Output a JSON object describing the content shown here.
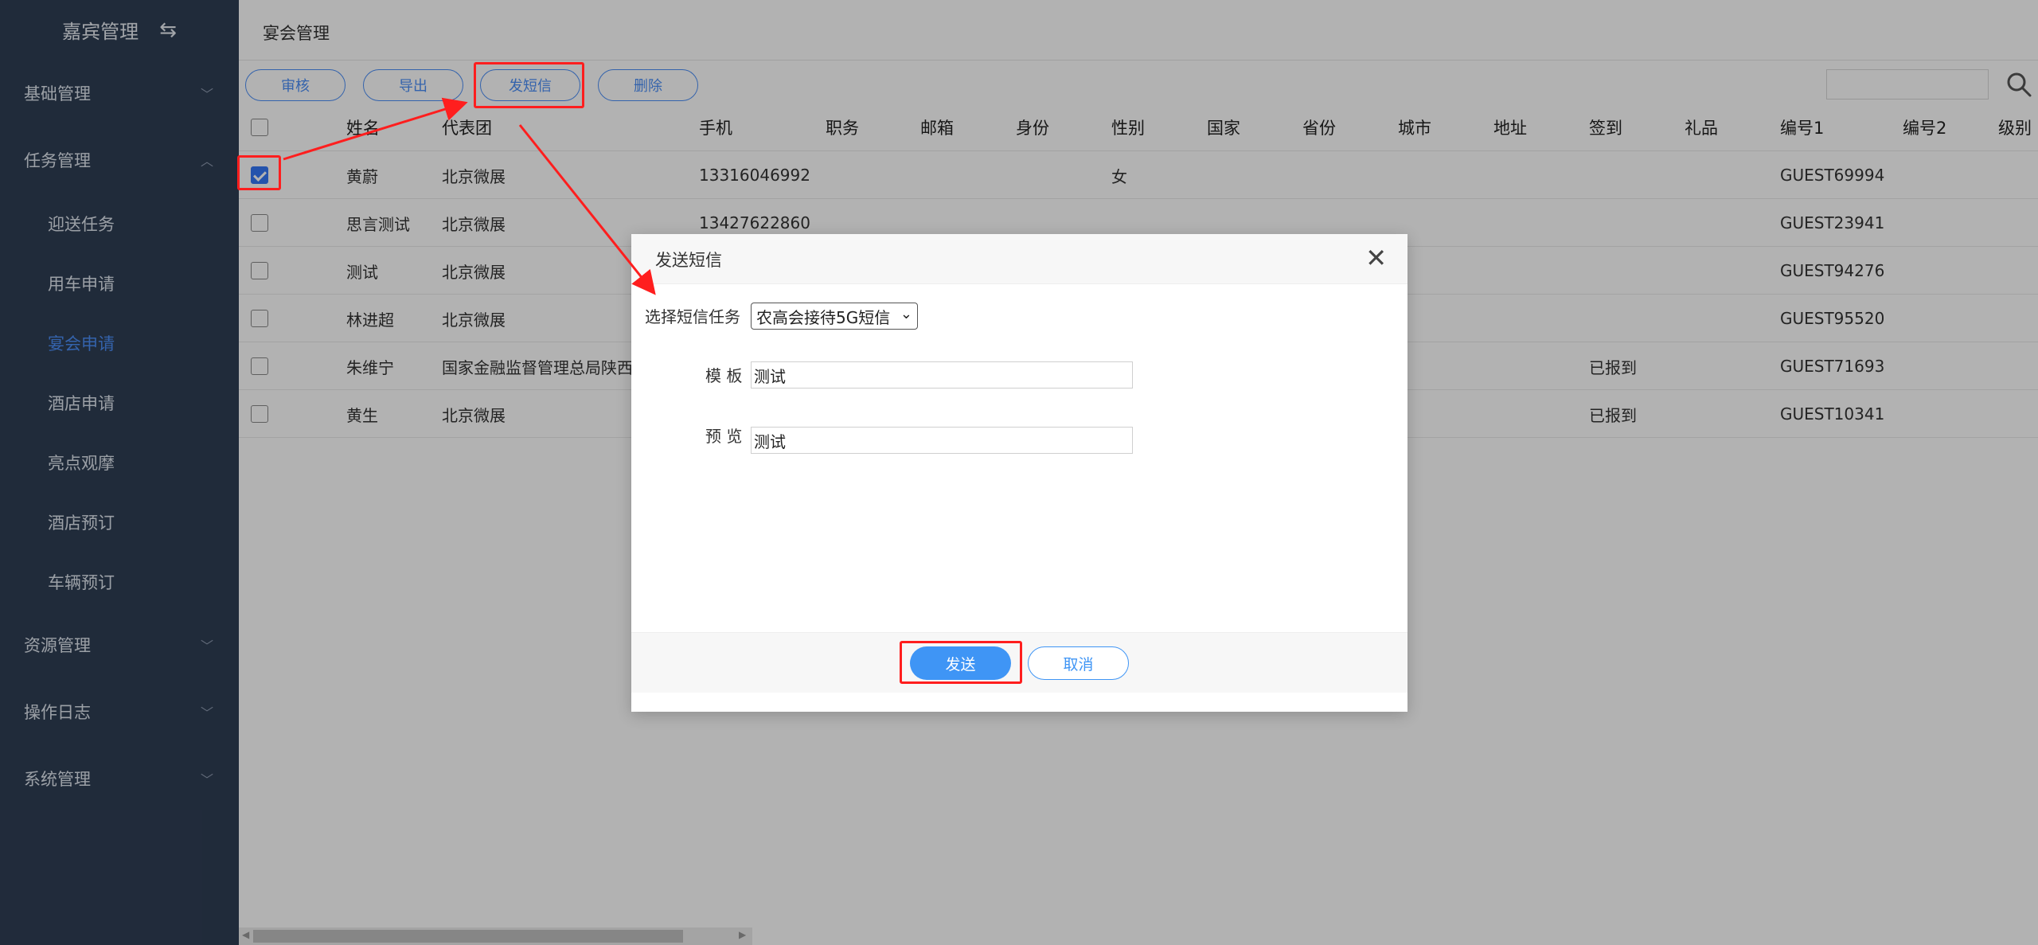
{
  "sidebar": {
    "title": "嘉宾管理",
    "toggle_icon": "swap-icon",
    "groups": [
      {
        "label": "基础管理",
        "expanded": false
      },
      {
        "label": "任务管理",
        "expanded": true
      },
      {
        "label": "资源管理",
        "expanded": false
      },
      {
        "label": "操作日志",
        "expanded": false
      },
      {
        "label": "系统管理",
        "expanded": false
      }
    ],
    "task_items": [
      "迎送任务",
      "用车申请",
      "宴会申请",
      "酒店申请",
      "亮点观摩",
      "酒店预订",
      "车辆预订"
    ],
    "active_item": "宴会申请",
    "colors": {
      "background": "#2f3e54",
      "active": "#4b8ef7"
    }
  },
  "main": {
    "tab_title": "宴会管理",
    "toolbar": {
      "approve_label": "审核",
      "export_label": "导出",
      "sms_label": "发短信",
      "delete_label": "删除"
    },
    "search": {
      "placeholder": ""
    },
    "table": {
      "headers": [
        "姓名",
        "代表团",
        "手机",
        "职务",
        "邮箱",
        "身份",
        "性别",
        "国家",
        "省份",
        "城市",
        "地址",
        "签到",
        "礼品",
        "编号1",
        "编号2",
        "级别"
      ],
      "rows": [
        {
          "checked": true,
          "name": "黄蔚",
          "delegation": "北京微展",
          "phone": "13316046992",
          "gender": "女",
          "checkin": "",
          "code1": "GUEST69994"
        },
        {
          "checked": false,
          "name": "思言测试",
          "delegation": "北京微展",
          "phone": "13427622860",
          "gender": "",
          "checkin": "",
          "code1": "GUEST23941"
        },
        {
          "checked": false,
          "name": "测试",
          "delegation": "北京微展",
          "phone": "",
          "gender": "",
          "checkin": "",
          "code1": "GUEST94276"
        },
        {
          "checked": false,
          "name": "林进超",
          "delegation": "北京微展",
          "phone": "",
          "gender": "",
          "checkin": "",
          "code1": "GUEST95520"
        },
        {
          "checked": false,
          "name": "朱维宁",
          "delegation": "国家金融监督管理总局陕西监",
          "phone": "",
          "gender": "",
          "checkin": "已报到",
          "code1": "GUEST71693"
        },
        {
          "checked": false,
          "name": "黄生",
          "delegation": "北京微展",
          "phone": "",
          "gender": "",
          "checkin": "已报到",
          "code1": "GUEST10341"
        }
      ]
    }
  },
  "dialog": {
    "title": "发送短信",
    "task_label": "选择短信任务",
    "task_selected": "农高会接待5G短信",
    "template_label": "模 板",
    "template_value": "测试",
    "preview_label": "预 览",
    "preview_value": "测试",
    "send_label": "发送",
    "cancel_label": "取消"
  },
  "colors": {
    "primary": "#3f95f5",
    "annotation": "#ff1e1e",
    "overlay": "rgba(0,0,0,0.3)"
  }
}
